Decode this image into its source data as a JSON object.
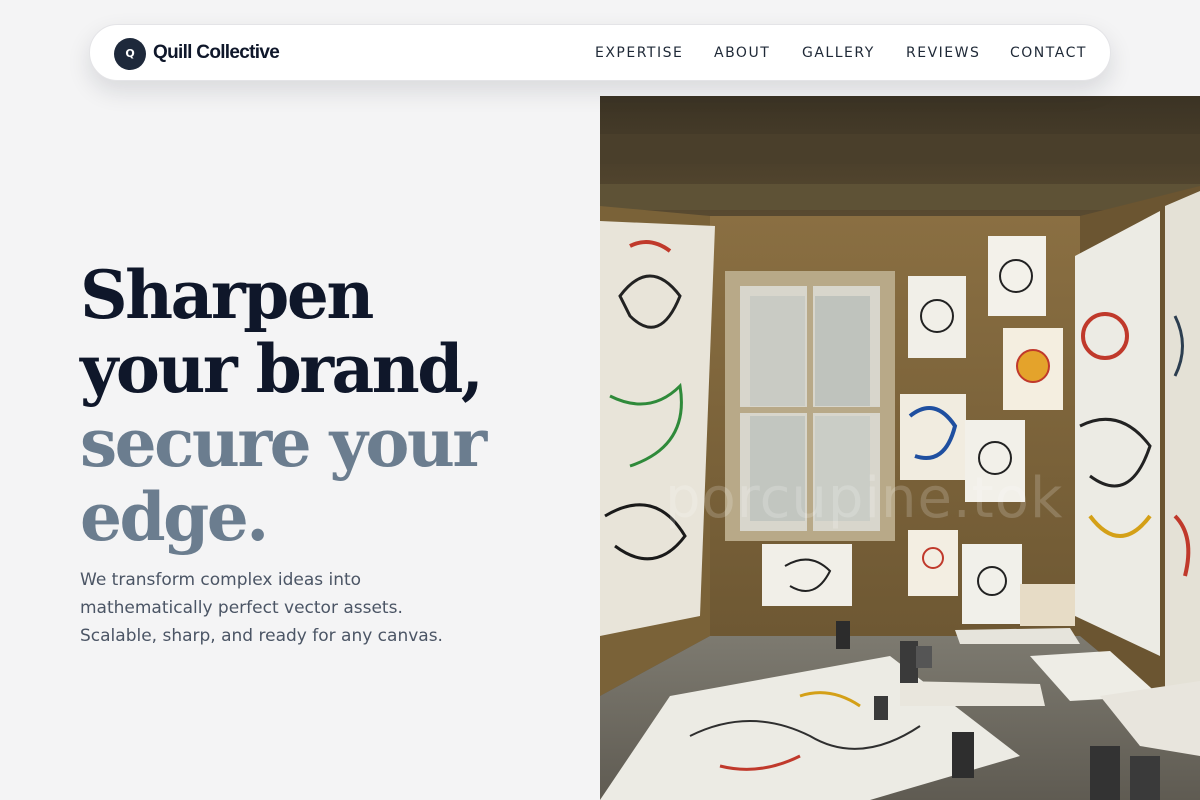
{
  "nav": {
    "logo_letter": "Q",
    "brand": "Quill Collective",
    "links": [
      "EXPERTISE",
      "ABOUT",
      "GALLERY",
      "REVIEWS",
      "CONTACT"
    ]
  },
  "hero": {
    "heading_lines": [
      "Sharpen",
      "your brand,",
      "secure your",
      "edge."
    ],
    "subtext_lines": [
      "We transform complex ideas into",
      "mathematically perfect vector assets.",
      "Scalable, sharp, and ready for any canvas."
    ]
  },
  "image": {
    "subject": "art-studio-room-with-drawings",
    "watermark": "porcupine.tok"
  },
  "colors": {
    "brand_dark": "#0f172a",
    "heading_muted": "#6b7d8f",
    "body_text": "#4b5565",
    "background": "#f4f4f5"
  }
}
